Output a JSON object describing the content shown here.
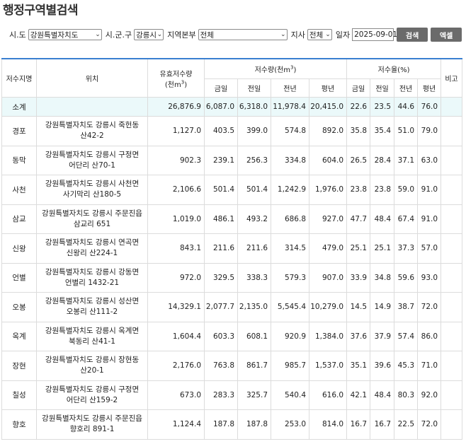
{
  "title": "행정구역별검색",
  "filters": {
    "sido_label": "시.도",
    "sido_value": "강원특별자치도",
    "gungu_label": "시.군.구",
    "gungu_value": "강릉시",
    "region_label": "지역본부",
    "region_value": "전체",
    "jisa_label": "지사",
    "jisa_value": "전체",
    "date_label": "일자",
    "date_value": "2025-09-01",
    "search_label": "검색",
    "excel_label": "엑셀"
  },
  "table": {
    "headers": {
      "name": "저수지명",
      "location": "위치",
      "effective": "유효저수량",
      "effective_unit": "(천m",
      "storage": "저수량(천m",
      "rate": "저수율(%)",
      "note": "비고",
      "sup3": "3",
      "close_paren": ")",
      "sub": [
        "금일",
        "전일",
        "전년",
        "평년",
        "금일",
        "전일",
        "전년",
        "평년"
      ]
    },
    "subtotal": {
      "name": "소계",
      "location": "",
      "effective": "26,876.9",
      "vals": [
        "6,087.0",
        "6,318.0",
        "11,978.4",
        "20,415.0",
        "22.6",
        "23.5",
        "44.6",
        "76.0"
      ]
    },
    "rows": [
      {
        "name": "경포",
        "loc1": "강원특별자치도 강릉시 죽헌동",
        "loc2": "산42-2",
        "effective": "1,127.0",
        "vals": [
          "403.5",
          "399.0",
          "574.8",
          "892.0",
          "35.8",
          "35.4",
          "51.0",
          "79.0"
        ]
      },
      {
        "name": "동막",
        "loc1": "강원특별자치도 강릉시 구정면",
        "loc2": "어단리 산70-1",
        "effective": "902.3",
        "vals": [
          "239.1",
          "256.3",
          "334.8",
          "604.0",
          "26.5",
          "28.4",
          "37.1",
          "63.0"
        ]
      },
      {
        "name": "사천",
        "loc1": "강원특별자치도 강릉시 사천면",
        "loc2": "사기막리 산180-5",
        "effective": "2,106.6",
        "vals": [
          "501.4",
          "501.4",
          "1,242.9",
          "1,976.0",
          "23.8",
          "23.8",
          "59.0",
          "91.0"
        ]
      },
      {
        "name": "삼교",
        "loc1": "강원특별자치도 강릉시 주문진읍",
        "loc2": "삼교리 651",
        "effective": "1,019.0",
        "vals": [
          "486.1",
          "493.2",
          "686.8",
          "927.0",
          "47.7",
          "48.4",
          "67.4",
          "91.0"
        ]
      },
      {
        "name": "신왕",
        "loc1": "강원특별자치도 강릉시 연곡면",
        "loc2": "신왕리 산224-1",
        "effective": "843.1",
        "vals": [
          "211.6",
          "211.6",
          "314.5",
          "479.0",
          "25.1",
          "25.1",
          "37.3",
          "57.0"
        ]
      },
      {
        "name": "언별",
        "loc1": "강원특별자치도 강릉시 강동면",
        "loc2": "언별리 1432-21",
        "effective": "972.0",
        "vals": [
          "329.5",
          "338.3",
          "579.3",
          "907.0",
          "33.9",
          "34.8",
          "59.6",
          "93.0"
        ]
      },
      {
        "name": "오봉",
        "loc1": "강원특별자치도 강릉시 성산면",
        "loc2": "오봉리 산111-2",
        "effective": "14,329.1",
        "vals": [
          "2,077.7",
          "2,135.0",
          "5,545.4",
          "10,279.0",
          "14.5",
          "14.9",
          "38.7",
          "72.0"
        ]
      },
      {
        "name": "옥계",
        "loc1": "강원특별자치도 강릉시 옥계면",
        "loc2": "북동리 산41-1",
        "effective": "1,604.4",
        "vals": [
          "603.3",
          "608.1",
          "920.9",
          "1,384.0",
          "37.6",
          "37.9",
          "57.4",
          "86.0"
        ]
      },
      {
        "name": "장현",
        "loc1": "강원특별자치도 강릉시 장현동",
        "loc2": "산20-1",
        "effective": "2,176.0",
        "vals": [
          "763.8",
          "861.7",
          "985.7",
          "1,537.0",
          "35.1",
          "39.6",
          "45.3",
          "71.0"
        ]
      },
      {
        "name": "칠성",
        "loc1": "강원특별자치도 강릉시 구정면",
        "loc2": "어단리 산159-2",
        "effective": "673.0",
        "vals": [
          "283.3",
          "325.7",
          "540.4",
          "616.0",
          "42.1",
          "48.4",
          "80.3",
          "92.0"
        ]
      },
      {
        "name": "향호",
        "loc1": "강원특별자치도 강릉시 주문진읍",
        "loc2": "향호리 891-1",
        "effective": "1,124.4",
        "vals": [
          "187.8",
          "187.8",
          "253.0",
          "814.0",
          "16.7",
          "16.7",
          "22.5",
          "72.0"
        ]
      }
    ]
  }
}
